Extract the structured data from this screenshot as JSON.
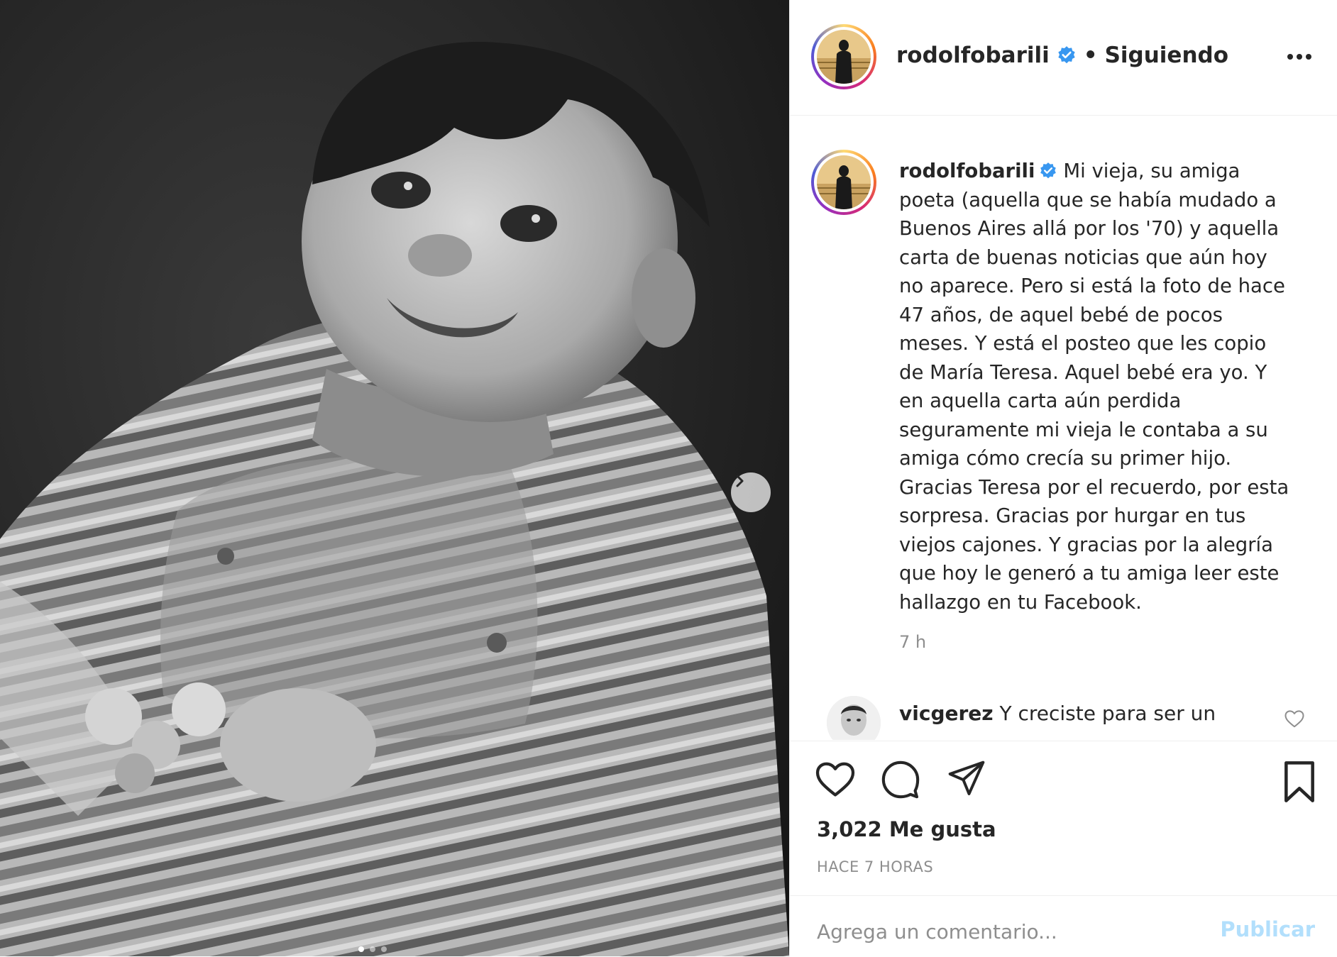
{
  "post": {
    "username": "rodolfobarili",
    "separator": "•",
    "follow_status": "Siguiendo",
    "more_icon": "more-horizontal-icon",
    "verified_color": "#3897f0"
  },
  "caption": {
    "username": "rodolfobarili",
    "text": "Mi vieja, su amiga poeta (aquella que se había mudado a Buenos Aires allá por los '70) y aquella carta de buenas noticias que aún hoy no aparece. Pero si está la foto de hace 47 años, de aquel bebé de pocos meses. Y está el posteo que les copio de María Teresa. Aquel bebé era yo. Y en aquella carta aún perdida seguramente mi vieja le contaba a su amiga cómo crecía su primer hijo. Gracias Teresa por el recuerdo, por esta sorpresa. Gracias por hurgar en tus viejos cajones. Y gracias por la alegría que hoy le generó a tu amiga leer este hallazgo en tu Facebook.",
    "time": "7 h"
  },
  "comments": [
    {
      "username": "vicgerez",
      "text": "Y creciste para ser un"
    }
  ],
  "actions": {
    "like_icon": "heart-icon",
    "comment_icon": "comment-icon",
    "share_icon": "share-icon",
    "save_icon": "bookmark-icon"
  },
  "likes": "3,022 Me gusta",
  "timestamp": "HACE 7 HORAS",
  "comment_box": {
    "placeholder": "Agrega un comentario...",
    "publish_label": "Publicar"
  },
  "carousel": {
    "next_icon": "chevron-right-icon",
    "slide_count": 3,
    "active_slide": 1
  },
  "colors": {
    "link_disabled": "#b2dffc",
    "secondary_text": "#8e8e8e",
    "border": "#efefef"
  }
}
